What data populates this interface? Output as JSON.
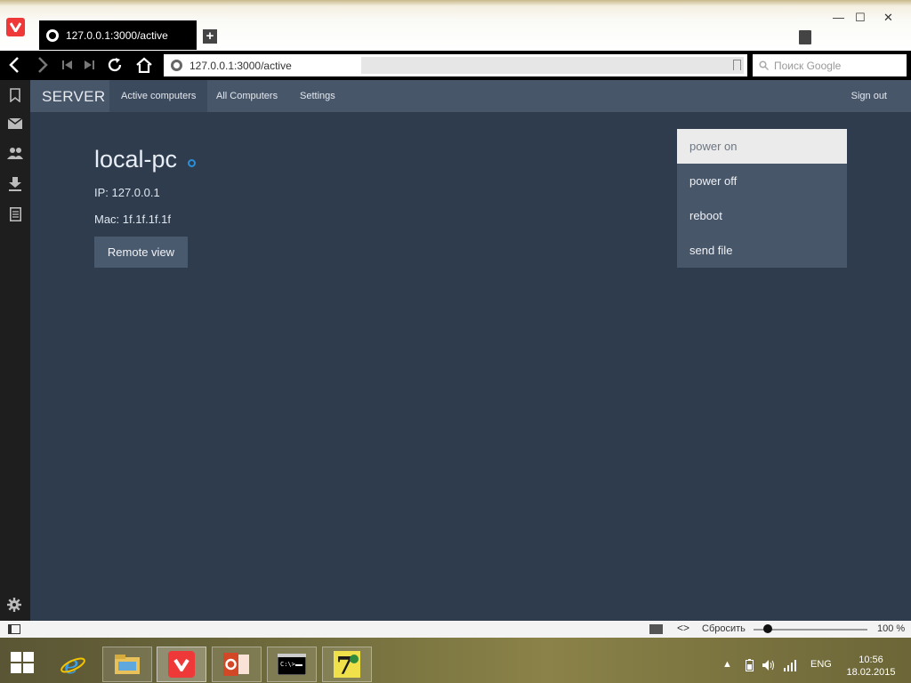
{
  "browser": {
    "tab_title": "127.0.0.1:3000/active",
    "address": "127.0.0.1:3000/active",
    "search_placeholder": "Поиск Google",
    "new_tab_symbol": "+",
    "minimize_symbol": "—",
    "maximize_symbol": "☐",
    "close_symbol": "✕",
    "nav_icons": [
      "back-icon",
      "forward-icon",
      "rewind-icon",
      "fast-forward-icon",
      "reload-icon",
      "home-icon"
    ]
  },
  "side_panel": {
    "icons": [
      "bookmarks-icon",
      "mail-icon",
      "contacts-icon",
      "downloads-icon",
      "notes-icon"
    ],
    "settings_icon": "gear-icon"
  },
  "app": {
    "brand": "SERVER",
    "nav": [
      {
        "label": "Active computers",
        "active": true
      },
      {
        "label": "All Computers",
        "active": false
      },
      {
        "label": "Settings",
        "active": false
      }
    ],
    "sign_out": "Sign out",
    "computer": {
      "name": "local-pc",
      "ip": "IP: 127.0.0.1",
      "mac": "Mac: 1f.1f.1f.1f",
      "status_color": "#2a8fd6"
    },
    "remote_view_label": "Remote view",
    "actions_menu": [
      {
        "label": "power on",
        "hovered": true
      },
      {
        "label": "power off",
        "hovered": false
      },
      {
        "label": "reboot",
        "hovered": false
      },
      {
        "label": "send file",
        "hovered": false
      }
    ]
  },
  "status_bar": {
    "reset_label": "Сбросить",
    "zoom_level": "100 %",
    "code_symbol": "<>"
  },
  "taskbar": {
    "apps": [
      "internet-explorer-icon",
      "file-explorer-icon",
      "vivaldi-icon",
      "powerpoint-icon",
      "command-prompt-icon",
      "7zip-icon"
    ],
    "language": "ENG",
    "time": "10:56",
    "date": "18.02.2015"
  },
  "colors": {
    "page_bg": "#2e3c4e",
    "navbar_bg": "#48566a",
    "accent_red": "#ef3939"
  }
}
